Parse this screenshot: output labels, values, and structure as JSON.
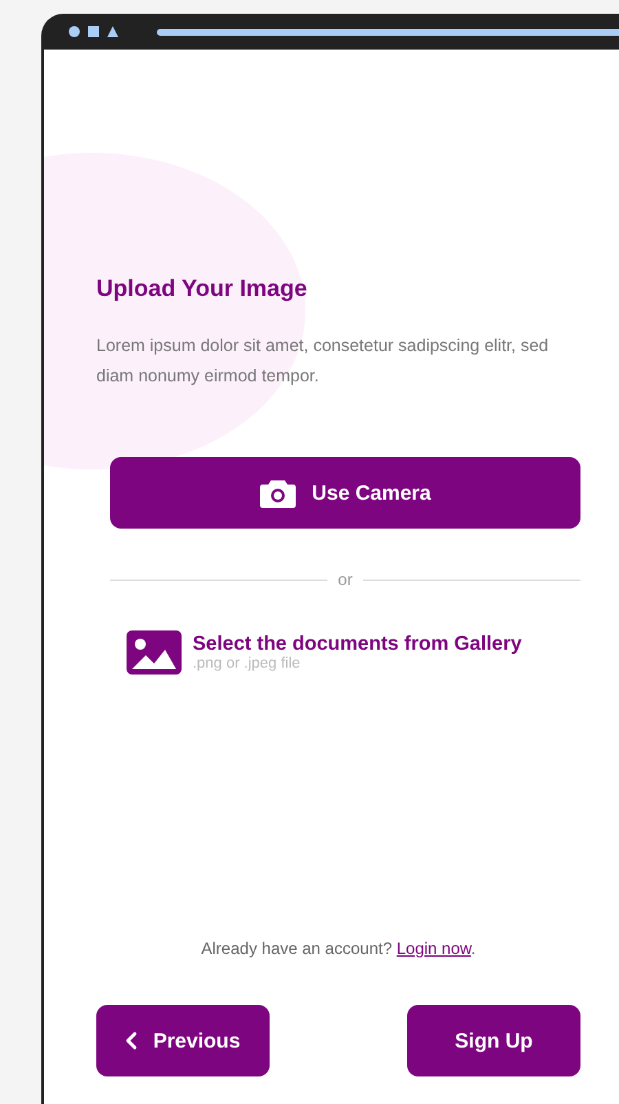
{
  "title": "Upload Your Image",
  "description": "Lorem ipsum dolor sit amet, consetetur sadipscing elitr, sed diam nonumy eirmod tempor.",
  "camera_button": {
    "label": "Use Camera"
  },
  "divider": {
    "label": "or"
  },
  "gallery": {
    "label": "Select the documents from Gallery",
    "hint": ".png or .jpeg file"
  },
  "login": {
    "text": "Already have an account?",
    "link": "Login now",
    "suffix": "."
  },
  "buttons": [
    {
      "kind": "back",
      "label": "Previous"
    },
    {
      "kind": "primary",
      "label": "Sign Up"
    }
  ]
}
